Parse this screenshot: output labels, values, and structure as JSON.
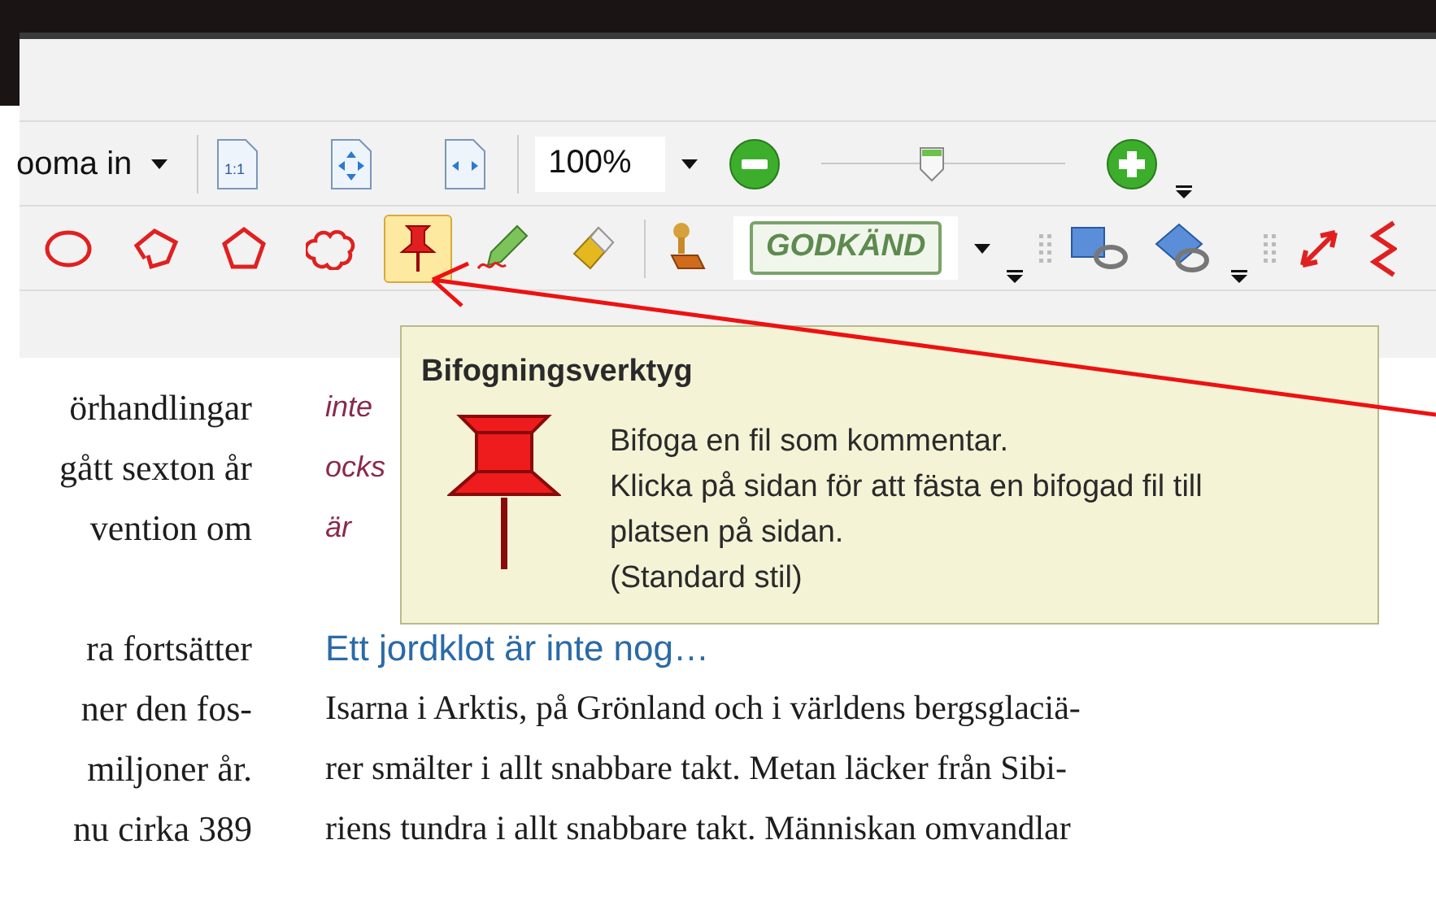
{
  "toolbar_row_1": {
    "zoom_dropdown": "ooma in",
    "actual_size_label": "1:1",
    "zoom_value": "100%",
    "zoom_slider": {
      "level": 0.45
    }
  },
  "toolbar_row_2": {
    "tools": [
      {
        "kind": "ellipse",
        "selected": false
      },
      {
        "kind": "polyline",
        "selected": false
      },
      {
        "kind": "polygon",
        "selected": false
      },
      {
        "kind": "cloud",
        "selected": false
      },
      {
        "kind": "pin",
        "selected": true
      },
      {
        "kind": "pencil",
        "selected": false
      },
      {
        "kind": "eraser",
        "selected": false
      }
    ],
    "stamp_label": "GODKÄND"
  },
  "tooltip": {
    "title": "Bifogningsverktyg",
    "lines": [
      "Bifoga en fil som kommentar.",
      "Klicka på sidan för att fästa en bifogad fil till",
      "platsen på sidan.",
      "(Standard stil)"
    ]
  },
  "document": {
    "left_column": [
      [
        "örhandlingar",
        "gått sexton år",
        "vention om"
      ],
      [
        "ra fortsätter",
        "ner den fos-",
        "miljoner år.",
        "nu cirka 389"
      ]
    ],
    "right_column_intro": [
      "inte",
      "ocks",
      "är"
    ],
    "heading": "Ett jordklot är inte nog…",
    "body": [
      "Isarna i Arktis, på Grönland och i världens bergsglaciä-",
      "rer smälter i allt snabbare takt. Metan läcker från Sibi-",
      "riens tundra i allt snabbare takt. Människan omvandlar"
    ]
  }
}
